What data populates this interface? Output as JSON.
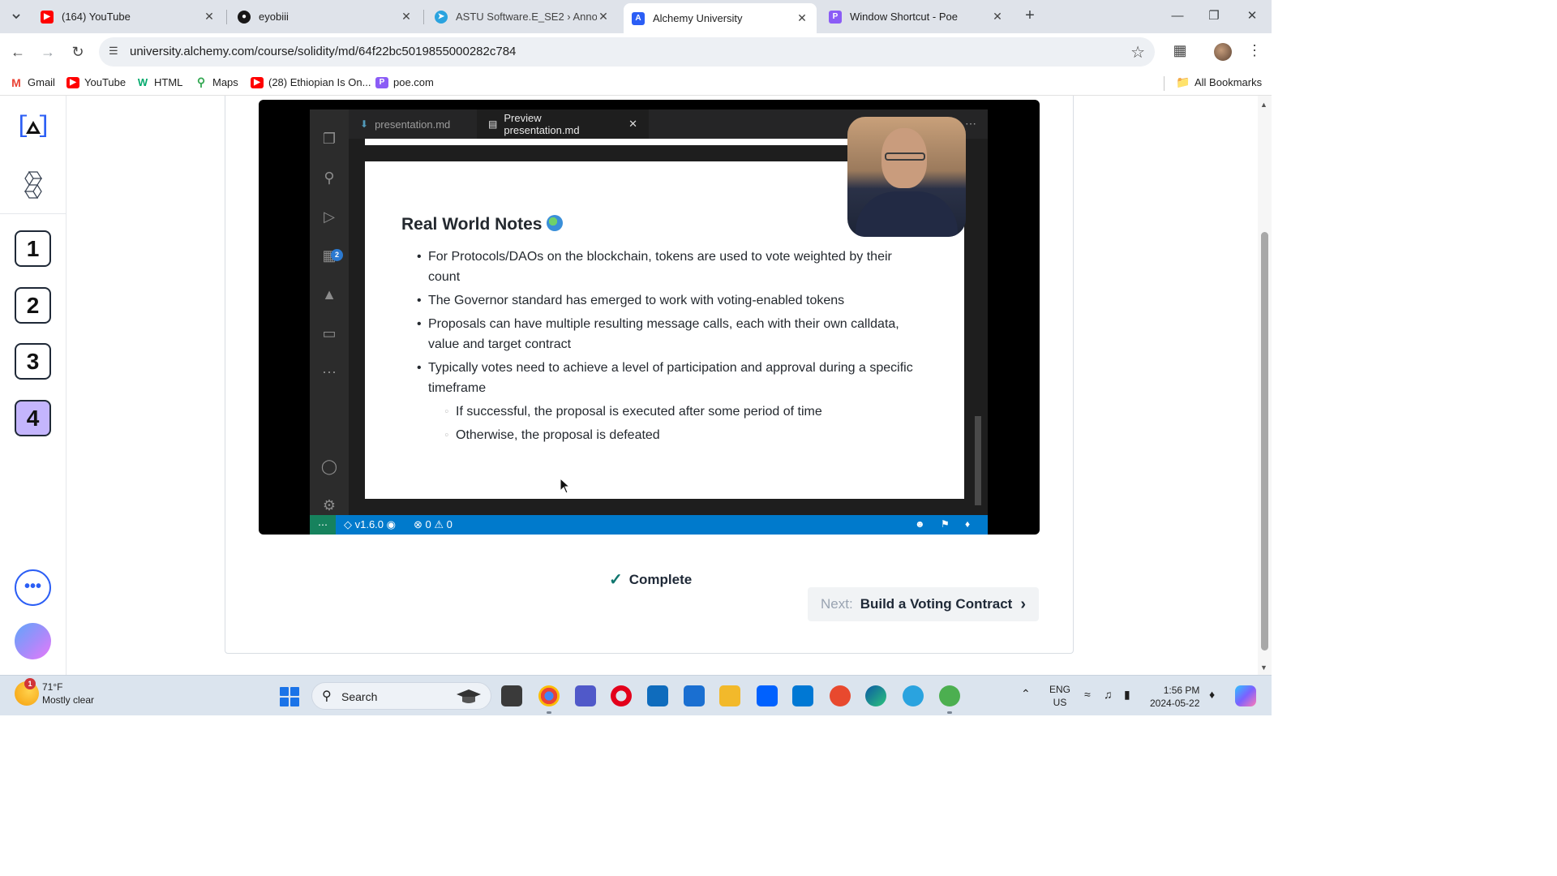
{
  "browser": {
    "tabs": [
      {
        "title": "(164) YouTube",
        "favicon": "youtube-icon",
        "color": "#ff0000"
      },
      {
        "title": "eyobiii",
        "favicon": "github-icon",
        "color": "#181717"
      },
      {
        "title": "ASTU Software.E_SE2 › Announc",
        "favicon": "telegram-icon",
        "color": "#2aa3df"
      },
      {
        "title": "Alchemy University",
        "favicon": "alchemy-icon",
        "color": "#2b5ef5",
        "active": true
      },
      {
        "title": "Window Shortcut - Poe",
        "favicon": "poe-icon",
        "color": "#8b5cf6"
      }
    ],
    "url": "university.alchemy.com/course/solidity/md/64f22bc5019855000282c784",
    "bookmarks": [
      {
        "label": "Gmail",
        "icon": "gmail-icon",
        "color": "#ea4335"
      },
      {
        "label": "YouTube",
        "icon": "youtube-icon",
        "color": "#ff0000"
      },
      {
        "label": "HTML",
        "icon": "w3-icon",
        "color": "#04aa6d"
      },
      {
        "label": "Maps",
        "icon": "maps-pin-icon",
        "color": "#34a853"
      },
      {
        "label": "(28) Ethiopian Is On...",
        "icon": "youtube-icon",
        "color": "#ff0000"
      },
      {
        "label": "poe.com",
        "icon": "poe-icon",
        "color": "#8b5cf6"
      }
    ],
    "all_bookmarks": "All Bookmarks"
  },
  "sidebar": {
    "steps": [
      "1",
      "2",
      "3",
      "4"
    ],
    "active_step": "4"
  },
  "video": {
    "editor_tabs": [
      {
        "label": "presentation.md",
        "icon": "markdown-icon"
      },
      {
        "label": "Preview presentation.md",
        "icon": "preview-icon",
        "active": true
      }
    ],
    "slide": {
      "title": "Real World Notes",
      "bullets": [
        "For Protocols/DAOs on the blockchain, tokens are used to vote weighted by their count",
        "The Governor standard has emerged to work with voting-enabled tokens",
        "Proposals can have multiple resulting message calls, each with their own calldata, value and target contract",
        "Typically votes need to achieve a level of participation and approval during a specific timeframe"
      ],
      "sub_bullets": [
        "If successful, the proposal is executed after some period of time",
        "Otherwise, the proposal is defeated"
      ]
    },
    "activity_badge": "2",
    "status": {
      "version": "v1.6.0",
      "errors": "0",
      "warnings": "0"
    }
  },
  "lesson": {
    "complete_label": "Complete",
    "next_prefix": "Next:",
    "next_title": "Build a Voting Contract"
  },
  "taskbar": {
    "weather_temp": "71°F",
    "weather_desc": "Mostly clear",
    "weather_badge": "1",
    "search_placeholder": "Search",
    "lang_top": "ENG",
    "lang_bottom": "US",
    "time": "1:56 PM",
    "date": "2024-05-22"
  }
}
